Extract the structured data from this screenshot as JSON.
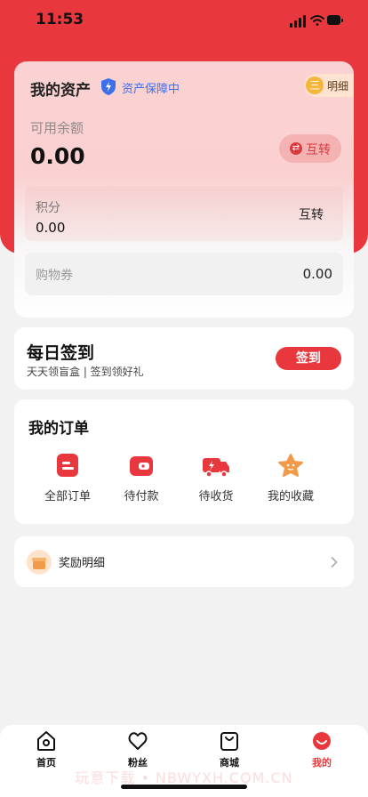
{
  "status_bar": {
    "time": "11:53"
  },
  "assets": {
    "title": "我的资产",
    "protection": "资产保障中",
    "detail_label": "明细",
    "detail_coin": "三",
    "balance_label": "可用余额",
    "balance_value": "0.00",
    "transfer_label": "互转",
    "points_label": "积分",
    "points_value": "0.00",
    "points_transfer": "互转",
    "voucher_label": "购物券",
    "voucher_value": "0.00"
  },
  "signin": {
    "title": "每日签到",
    "subtitle": "天天领盲盒 | 签到领好礼",
    "button": "签到"
  },
  "orders": {
    "title": "我的订单",
    "items": [
      {
        "label": "全部订单",
        "icon": "all-orders-icon"
      },
      {
        "label": "待付款",
        "icon": "wallet-icon"
      },
      {
        "label": "待收货",
        "icon": "truck-icon"
      },
      {
        "label": "我的收藏",
        "icon": "star-icon"
      }
    ]
  },
  "reward": {
    "label": "奖励明细"
  },
  "tabbar": {
    "items": [
      {
        "label": "首页",
        "icon": "home-icon"
      },
      {
        "label": "粉丝",
        "icon": "heart-icon"
      },
      {
        "label": "商城",
        "icon": "shopping-bag-icon"
      },
      {
        "label": "我的",
        "icon": "profile-icon"
      }
    ],
    "active_index": 3
  },
  "watermark": "玩意下载 • NBWYXH.COM.CN",
  "colors": {
    "brand_red": "#e8383d",
    "protect_blue": "#3d6fe8"
  }
}
